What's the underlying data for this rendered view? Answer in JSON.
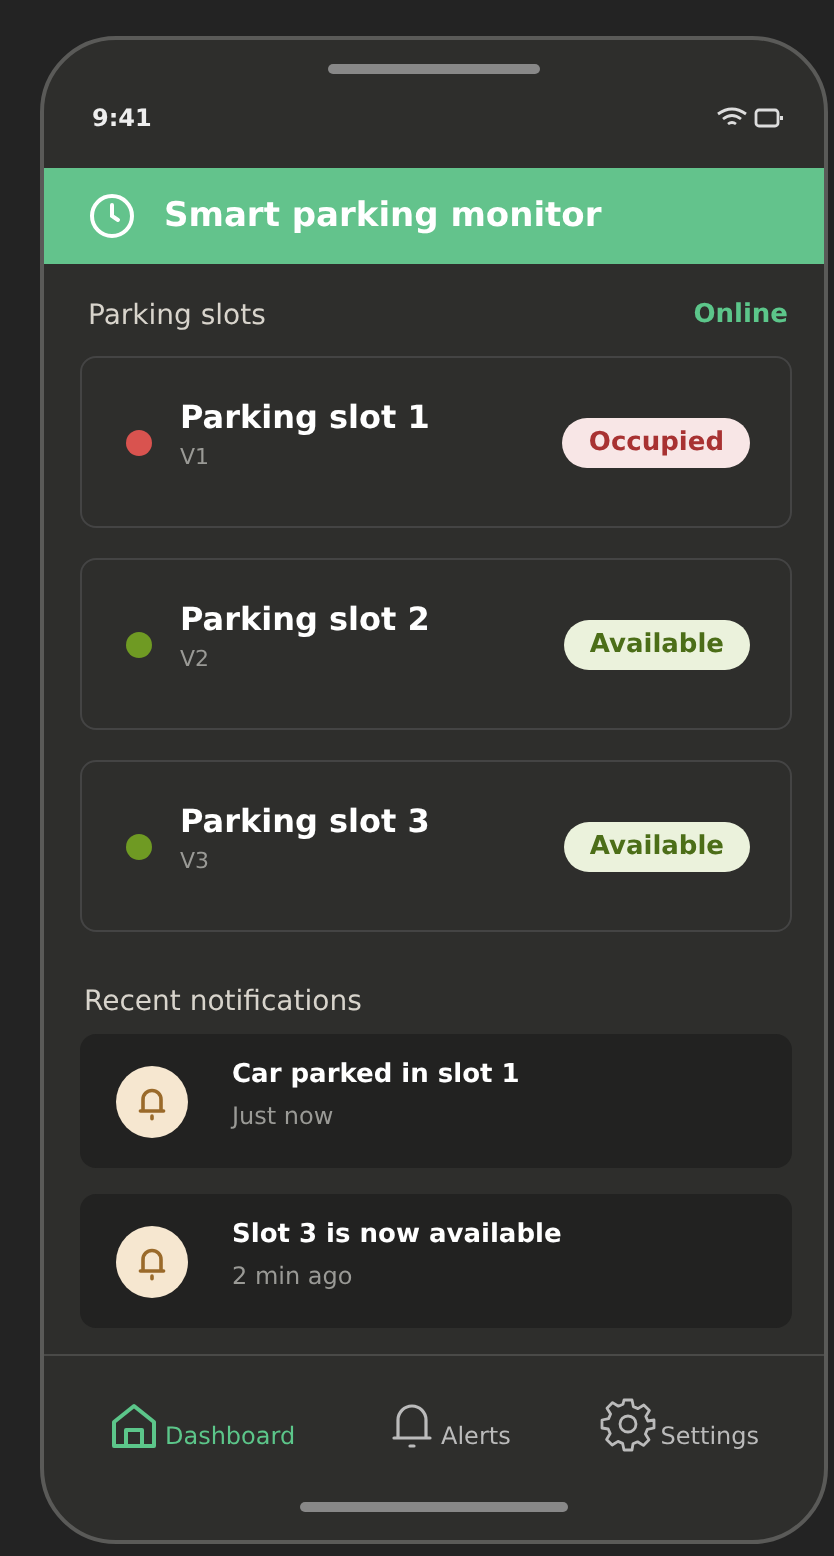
{
  "status_bar": {
    "time": "9:41"
  },
  "header": {
    "title": "Smart parking monitor"
  },
  "slots_section": {
    "title": "Parking slots",
    "connection": "Online"
  },
  "slots": [
    {
      "name": "Parking slot 1",
      "code": "V1",
      "kind": "occupied",
      "label": "Occupied",
      "color": "#d9534f"
    },
    {
      "name": "Parking slot 2",
      "code": "V2",
      "kind": "available",
      "label": "Available",
      "color": "#6f9a23"
    },
    {
      "name": "Parking slot 3",
      "code": "V3",
      "kind": "available",
      "label": "Available",
      "color": "#6f9a23"
    }
  ],
  "notifications_section": {
    "title": "Recent notifications"
  },
  "notifications": [
    {
      "title": "Car parked in slot 1",
      "time": "Just now"
    },
    {
      "title": "Slot 3 is now available",
      "time": "2 min ago"
    }
  ],
  "nav": [
    {
      "kind": "home",
      "label": "Dashboard",
      "selected": true
    },
    {
      "kind": "bell",
      "label": "Alerts",
      "selected": false
    },
    {
      "kind": "gear",
      "label": "Settings",
      "selected": false
    }
  ]
}
